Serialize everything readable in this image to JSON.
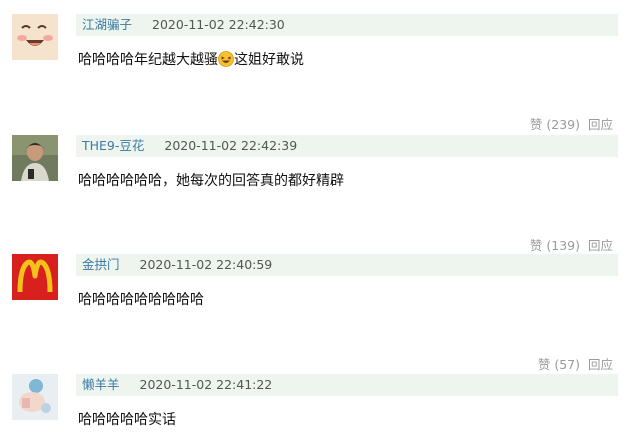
{
  "comments": [
    {
      "username": "江湖骗子",
      "time": "2020-11-02 22:42:30",
      "text": "哈哈哈哈年纪越大越骚",
      "text_after_emoji": "这姐好敢说",
      "like_label": "赞 (239)",
      "reply_label": "回应"
    },
    {
      "username": "THE9-豆花",
      "time": "2020-11-02 22:42:39",
      "text": "哈哈哈哈哈哈，她每次的回答真的都好精辟",
      "like_label": "赞 (139)",
      "reply_label": "回应"
    },
    {
      "username": "金拱门",
      "time": "2020-11-02 22:40:59",
      "text": "哈哈哈哈哈哈哈哈哈",
      "like_label": "赞 (57)",
      "reply_label": "回应"
    },
    {
      "username": "懒羊羊",
      "time": "2020-11-02 22:41:22",
      "text": "哈哈哈哈哈实话"
    }
  ],
  "colors": {
    "meta_bg": "#eef4ee",
    "username": "#3b7aa4",
    "action_text": "#9a9a9a",
    "mcdonalds_red": "#d8201f",
    "mcdonalds_yellow": "#f4c21a"
  }
}
